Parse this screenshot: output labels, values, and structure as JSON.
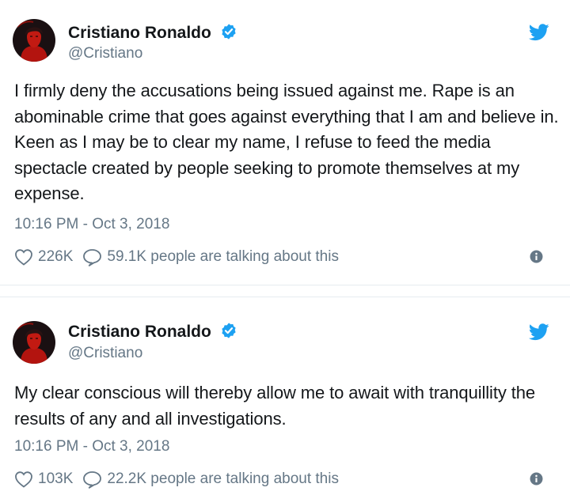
{
  "tweets": [
    {
      "author": {
        "name": "Cristiano Ronaldo",
        "handle": "@Cristiano",
        "verified": true
      },
      "text": "I firmly deny the accusations being issued against me. Rape is an abominable crime that goes against everything that I am and believe in. Keen as I may be to clear my name, I refuse to feed the media spectacle created by people seeking to promote themselves at my expense.",
      "timestamp": "10:16 PM - Oct 3, 2018",
      "likes": "226K",
      "talking": "59.1K people are talking about this"
    },
    {
      "author": {
        "name": "Cristiano Ronaldo",
        "handle": "@Cristiano",
        "verified": true
      },
      "text": "My clear conscious will thereby allow me to await with tranquillity the results of any and all investigations.",
      "timestamp": "10:16 PM - Oct 3, 2018",
      "likes": "103K",
      "talking": "22.2K people are talking about this"
    }
  ],
  "colors": {
    "twitter_blue": "#1da1f2",
    "text_primary": "#14171a",
    "text_secondary": "#657786",
    "divider": "#e6ecf0"
  },
  "icons": {
    "verified": "verified-badge-icon",
    "brand": "twitter-bird-icon",
    "like": "heart-icon",
    "reply": "speech-bubble-icon",
    "info": "info-icon"
  }
}
